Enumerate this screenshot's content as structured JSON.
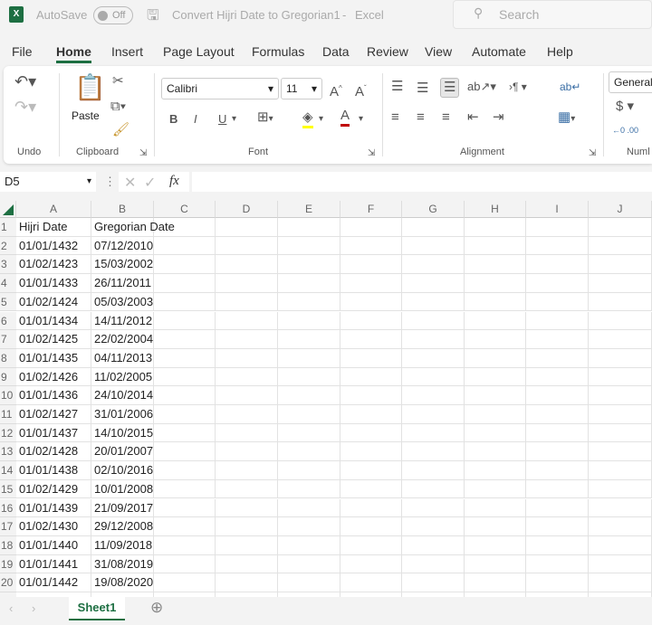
{
  "titlebar": {
    "autosave_label": "AutoSave",
    "autosave_state": "Off",
    "title": "Convert Hijri Date to Gregorian1",
    "app": "Excel",
    "search_placeholder": "Search"
  },
  "tabs": [
    "File",
    "Home",
    "Insert",
    "Page Layout",
    "Formulas",
    "Data",
    "Review",
    "View",
    "Automate",
    "Help"
  ],
  "active_tab": "Home",
  "ribbon": {
    "groups": {
      "undo": "Undo",
      "clipboard": "Clipboard",
      "font": "Font",
      "alignment": "Alignment",
      "number": "Numl"
    },
    "paste": "Paste",
    "font_name": "Calibri",
    "font_size": "11",
    "number_format": "General",
    "bold": "B",
    "italic": "I",
    "underline": "U",
    "font_color_accent": "#c00000",
    "highlight_accent": "#ffff00"
  },
  "formula_bar": {
    "name_box": "D5",
    "fx": "fx",
    "value": ""
  },
  "columns": [
    "A",
    "B",
    "C",
    "D",
    "E",
    "F",
    "G",
    "H",
    "I",
    "J"
  ],
  "rows": [
    [
      "Hijri Date",
      "Gregorian Date"
    ],
    [
      "01/01/1432",
      "07/12/2010"
    ],
    [
      "01/02/1423",
      "15/03/2002"
    ],
    [
      "01/01/1433",
      "26/11/2011"
    ],
    [
      "01/02/1424",
      "05/03/2003"
    ],
    [
      "01/01/1434",
      "14/11/2012"
    ],
    [
      "01/02/1425",
      "22/02/2004"
    ],
    [
      "01/01/1435",
      "04/11/2013"
    ],
    [
      "01/02/1426",
      "11/02/2005"
    ],
    [
      "01/01/1436",
      "24/10/2014"
    ],
    [
      "01/02/1427",
      "31/01/2006"
    ],
    [
      "01/01/1437",
      "14/10/2015"
    ],
    [
      "01/02/1428",
      "20/01/2007"
    ],
    [
      "01/01/1438",
      "02/10/2016"
    ],
    [
      "01/02/1429",
      "10/01/2008"
    ],
    [
      "01/01/1439",
      "21/09/2017"
    ],
    [
      "01/02/1430",
      "29/12/2008"
    ],
    [
      "01/01/1440",
      "11/09/2018"
    ],
    [
      "01/01/1441",
      "31/08/2019"
    ],
    [
      "01/01/1442",
      "19/08/2020"
    ]
  ],
  "sheets": [
    "Sheet1"
  ],
  "accent": "#1d6f42"
}
